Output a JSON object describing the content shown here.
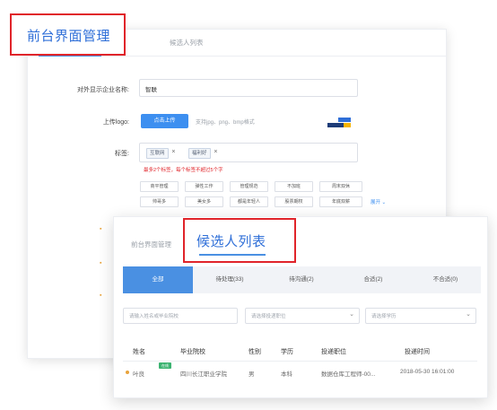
{
  "back": {
    "tab_active": "前台界面管理",
    "tab_second": "候选人列表",
    "company_label": "对外显示企业名称:",
    "company_value": "智联",
    "logo_label": "上传logo:",
    "upload_button": "点击上传",
    "upload_hint": "支持jpg、png、bmp格式",
    "tags_label": "标签:",
    "tags": [
      {
        "label": "互联网"
      },
      {
        "label": "福利好"
      }
    ],
    "tags_hint": "最多2个标签，每个标签不超过5个字",
    "tag_options": [
      "商平管理",
      "弹性工作",
      "管理规范",
      "不加班",
      "周末双休",
      "帅哥多",
      "美女多",
      "都是年轻人",
      "股票期权",
      "年底双薪"
    ],
    "expand_label": "展开 ⌄"
  },
  "front": {
    "tab_back": "前台界面管理",
    "title": "候选人列表",
    "status_tabs": [
      {
        "label": "全部",
        "active": true
      },
      {
        "label": "待处理(33)",
        "active": false
      },
      {
        "label": "待沟通(2)",
        "active": false
      },
      {
        "label": "合适(2)",
        "active": false
      },
      {
        "label": "不合适(0)",
        "active": false
      }
    ],
    "filters": {
      "search_placeholder": "请输入姓名或毕业院校",
      "position_placeholder": "请选择投递职位",
      "education_placeholder": "请选择学历"
    },
    "table": {
      "headers": [
        "姓名",
        "毕业院校",
        "性别",
        "学历",
        "投递职位",
        "投递时间"
      ],
      "rows": [
        {
          "name": "叶良",
          "badge": "在线",
          "school": "四川长江职业学院",
          "gender": "男",
          "education": "本科",
          "position": "数据仓库工程师-00...",
          "time": "2018-05-30 16:01:00"
        }
      ]
    }
  },
  "colors": {
    "accent": "#4a90e2",
    "highlight": "#e0242a",
    "title_blue": "#2f6fd8"
  }
}
